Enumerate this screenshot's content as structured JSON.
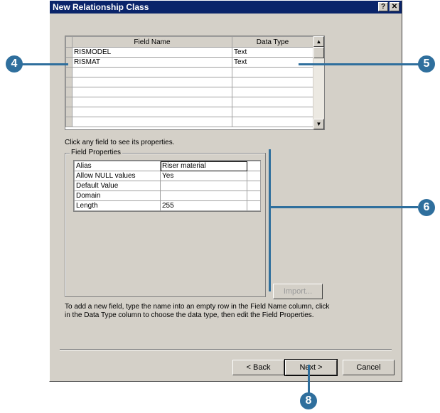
{
  "window": {
    "title": "New Relationship Class",
    "help_glyph": "?",
    "close_glyph": "✕"
  },
  "fields_grid": {
    "columns": [
      "Field Name",
      "Data Type"
    ],
    "rows": [
      {
        "name": "RISMODEL",
        "type": "Text"
      },
      {
        "name": "RISMAT",
        "type": "Text"
      },
      {
        "name": "",
        "type": ""
      },
      {
        "name": "",
        "type": ""
      },
      {
        "name": "",
        "type": ""
      },
      {
        "name": "",
        "type": ""
      },
      {
        "name": "",
        "type": ""
      },
      {
        "name": "",
        "type": ""
      }
    ]
  },
  "hint": "Click any field to see its properties.",
  "field_properties": {
    "title": "Field Properties",
    "rows": [
      {
        "label": "Alias",
        "value": "Riser material"
      },
      {
        "label": "Allow NULL values",
        "value": "Yes"
      },
      {
        "label": "Default Value",
        "value": ""
      },
      {
        "label": "Domain",
        "value": ""
      },
      {
        "label": "Length",
        "value": "255"
      }
    ],
    "import_label": "Import..."
  },
  "instructions": "To add a new field, type the name into an empty row in the Field Name column, click in the Data Type column to choose the data type, then edit the Field Properties.",
  "buttons": {
    "back": "< Back",
    "next": "Next >",
    "cancel": "Cancel"
  },
  "callouts": {
    "c4": "4",
    "c5": "5",
    "c6": "6",
    "c8": "8"
  },
  "colors": {
    "titlebar": "#0a246a",
    "dialog": "#d4d0c8",
    "callout": "#2f6f9d"
  }
}
